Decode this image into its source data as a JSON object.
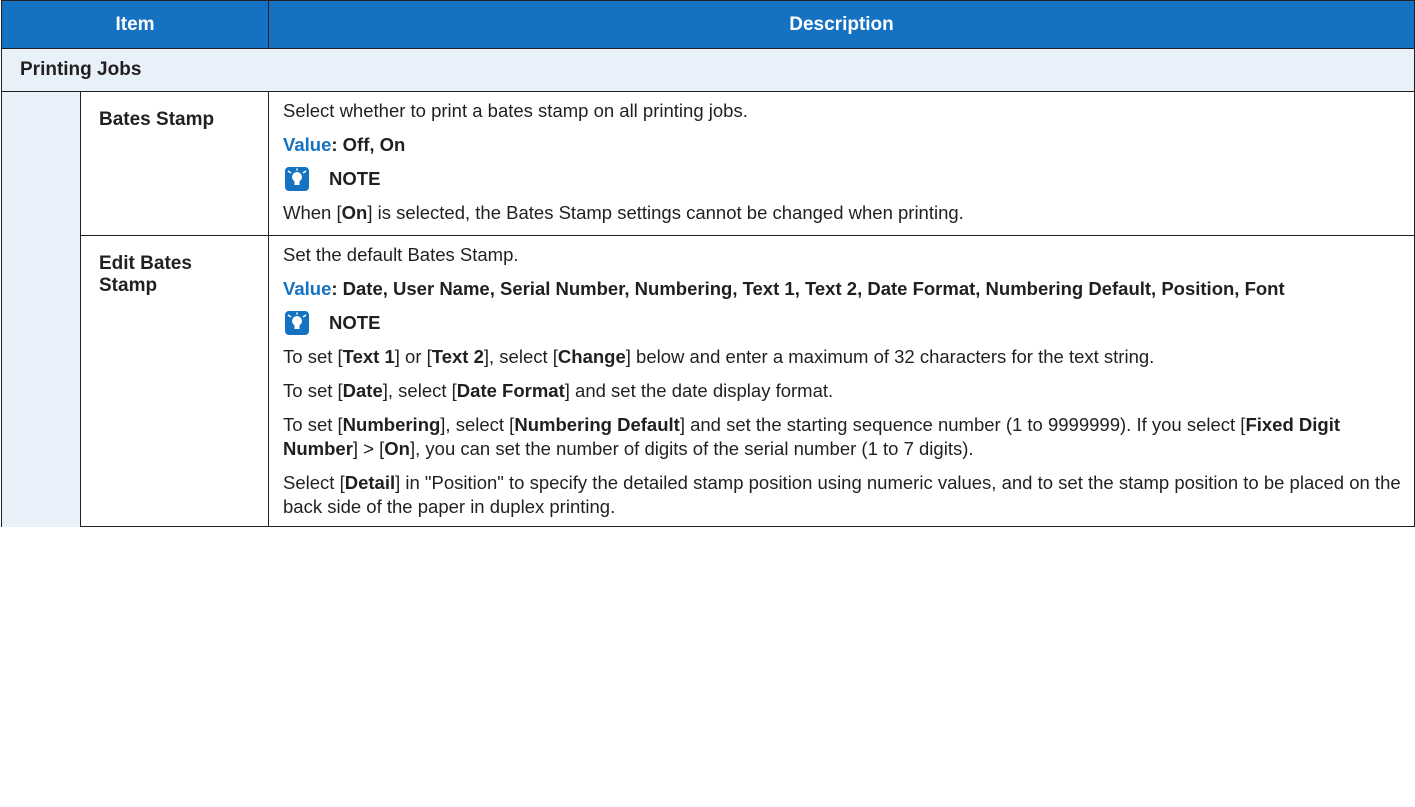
{
  "header": {
    "item_label": "Item",
    "description_label": "Description"
  },
  "section": {
    "title": "Printing Jobs"
  },
  "rows": [
    {
      "item": "Bates Stamp",
      "lines": [
        "Select whether to print a bates stamp on all printing jobs."
      ],
      "value_key": "Value",
      "value_text": ": Off, On",
      "note_label": "NOTE",
      "note_parts": [
        "When [",
        "On",
        "] is selected, the Bates Stamp settings cannot be changed when printing."
      ]
    },
    {
      "item": "Edit Bates Stamp",
      "lines": [
        "Set the default Bates Stamp."
      ],
      "value_key": "Value",
      "value_text": ": Date, User Name, Serial Number, Numbering, Text 1, Text 2, Date Format, Numbering Default, Position, Font",
      "note_label": "NOTE",
      "note_para1": [
        "To set [",
        "Text 1",
        "] or [",
        "Text 2",
        "], select [",
        "Change",
        "] below and enter a maximum of 32 characters for the text string."
      ],
      "note_para2": [
        "To set [",
        "Date",
        "], select [",
        "Date Format",
        "] and set the date display format."
      ],
      "note_para3": [
        "To set [",
        "Numbering",
        "], select [",
        "Numbering Default",
        "] and set the starting sequence number (1 to 9999999). If you select [",
        "Fixed Digit Number",
        "] > [",
        "On",
        "], you can set the number of digits of the serial number (1 to 7 digits)."
      ],
      "note_para4": [
        "Select [",
        "Detail",
        "] in \"Position\" to specify the detailed stamp position using numeric values, and to set the stamp position to be placed on the back side of the paper in duplex printing."
      ]
    }
  ],
  "colors": {
    "header_bg": "#1572c2",
    "section_bg": "#e8f1fa",
    "value_key": "#1572c2"
  },
  "icons": {
    "note": "note-lightbulb-icon"
  }
}
